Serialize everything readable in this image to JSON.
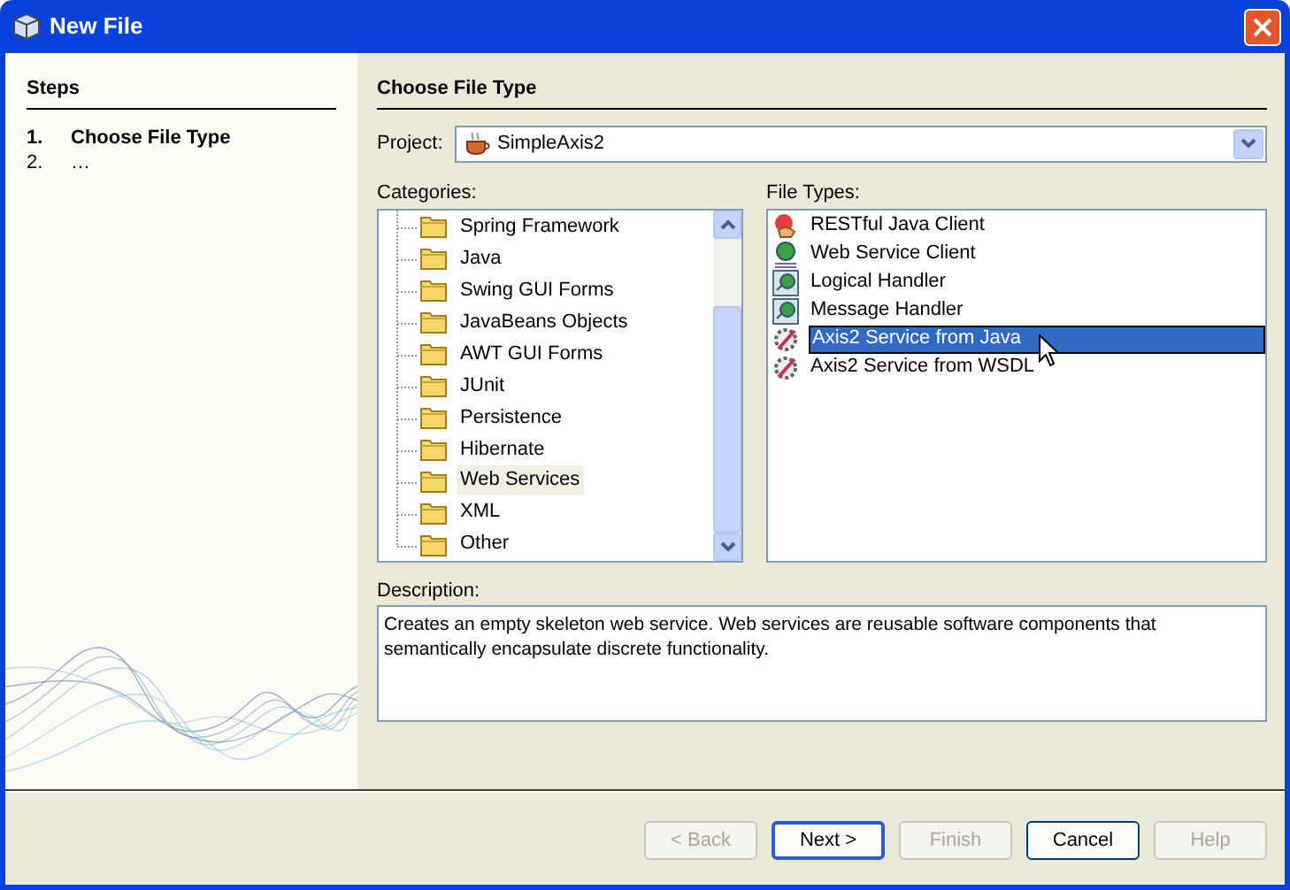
{
  "window": {
    "title": "New File"
  },
  "steps": {
    "title": "Steps",
    "items": [
      {
        "number": "1.",
        "label": "Choose File Type",
        "current": true
      },
      {
        "number": "2.",
        "label": "…",
        "current": false
      }
    ]
  },
  "panel": {
    "title": "Choose File Type"
  },
  "project": {
    "label": "Project:",
    "value": "SimpleAxis2"
  },
  "categories": {
    "label": "Categories:",
    "items": [
      {
        "label": "Spring Framework",
        "selected": false
      },
      {
        "label": "Java",
        "selected": false
      },
      {
        "label": "Swing GUI Forms",
        "selected": false
      },
      {
        "label": "JavaBeans Objects",
        "selected": false
      },
      {
        "label": "AWT GUI Forms",
        "selected": false
      },
      {
        "label": "JUnit",
        "selected": false
      },
      {
        "label": "Persistence",
        "selected": false
      },
      {
        "label": "Hibernate",
        "selected": false
      },
      {
        "label": "Web Services",
        "selected": true
      },
      {
        "label": "XML",
        "selected": false
      },
      {
        "label": "Other",
        "selected": false
      }
    ]
  },
  "file_types": {
    "label": "File Types:",
    "items": [
      {
        "label": "RESTful Java Client",
        "kind": "restful",
        "selected": false
      },
      {
        "label": "Web Service Client",
        "kind": "client",
        "selected": false
      },
      {
        "label": "Logical Handler",
        "kind": "handler",
        "selected": false
      },
      {
        "label": "Message Handler",
        "kind": "handler",
        "selected": false
      },
      {
        "label": "Axis2 Service from Java",
        "kind": "axis",
        "selected": true
      },
      {
        "label": "Axis2 Service from WSDL",
        "kind": "axis",
        "selected": false
      }
    ]
  },
  "description": {
    "label": "Description:",
    "text": "Creates an empty skeleton web service. Web services are reusable software components that semantically encapsulate discrete functionality."
  },
  "buttons": [
    {
      "label": "< Back",
      "disabled": true,
      "default": false
    },
    {
      "label": "Next >",
      "disabled": false,
      "default": true
    },
    {
      "label": "Finish",
      "disabled": true,
      "default": false
    },
    {
      "label": "Cancel",
      "disabled": false,
      "default": false
    },
    {
      "label": "Help",
      "disabled": true,
      "default": false
    }
  ]
}
